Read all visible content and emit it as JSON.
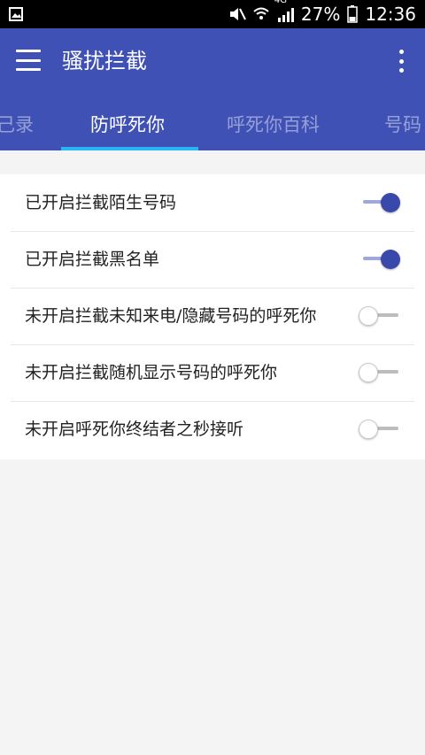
{
  "status_bar": {
    "left_icon": "image-icon",
    "icons": [
      "mute-icon",
      "wifi-icon",
      "4g-signal-icon",
      "battery-icon"
    ],
    "network_label": "4G",
    "battery": "27%",
    "time": "12:36"
  },
  "app_bar": {
    "title": "骚扰拦截",
    "menu_icon": "hamburger-menu-icon",
    "more_icon": "more-vert-icon",
    "color": "#3f51b5"
  },
  "tabs": [
    {
      "label": "记录",
      "visible_text": "己录",
      "active": false
    },
    {
      "label": "防呼死你",
      "active": true
    },
    {
      "label": "呼死你百科",
      "active": false
    },
    {
      "label": "号码",
      "active": false
    }
  ],
  "settings": [
    {
      "label": "已开启拦截陌生号码",
      "on": true
    },
    {
      "label": "已开启拦截黑名单",
      "on": true
    },
    {
      "label": "未开启拦截未知来电/隐藏号码的呼死你",
      "on": false
    },
    {
      "label": "未开启拦截随机显示号码的呼死你",
      "on": false
    },
    {
      "label": "未开启呼死你终结者之秒接听",
      "on": false
    }
  ],
  "colors": {
    "accent": "#3949ab",
    "tab_indicator": "#29b6f6"
  }
}
